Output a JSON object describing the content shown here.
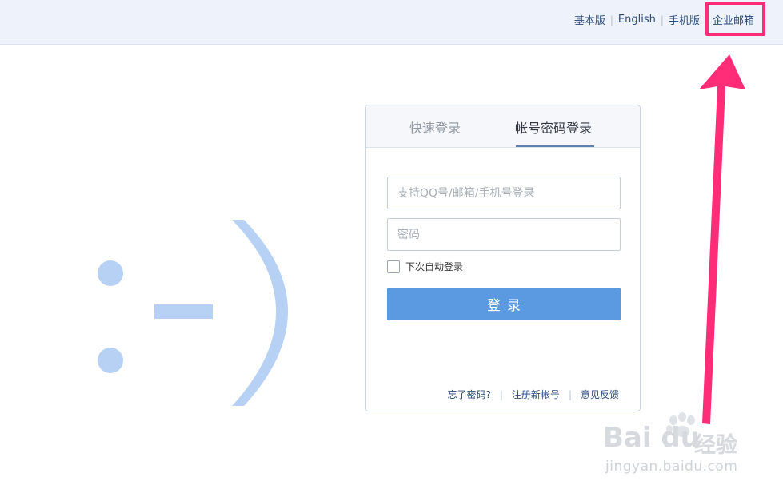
{
  "topbar": {
    "links": [
      "基本版",
      "English",
      "手机版",
      "企业邮箱"
    ]
  },
  "login": {
    "tabs": [
      "快速登录",
      "帐号密码登录"
    ],
    "username_placeholder": "支持QQ号/邮箱/手机号登录",
    "password_placeholder": "密码",
    "remember_label": "下次自动登录",
    "submit_label": "登录",
    "footer_links": [
      "忘了密码?",
      "注册新帐号",
      "意见反馈"
    ]
  },
  "watermark": {
    "brand_latin": "Bai du",
    "brand_cn": "经验",
    "url": "jingyan.baidu.com"
  },
  "colors": {
    "accent": "#5b9ae0",
    "smiley": "#b7d1f5",
    "highlight": "#ff2d78",
    "topbar_bg": "#eef3fb"
  }
}
